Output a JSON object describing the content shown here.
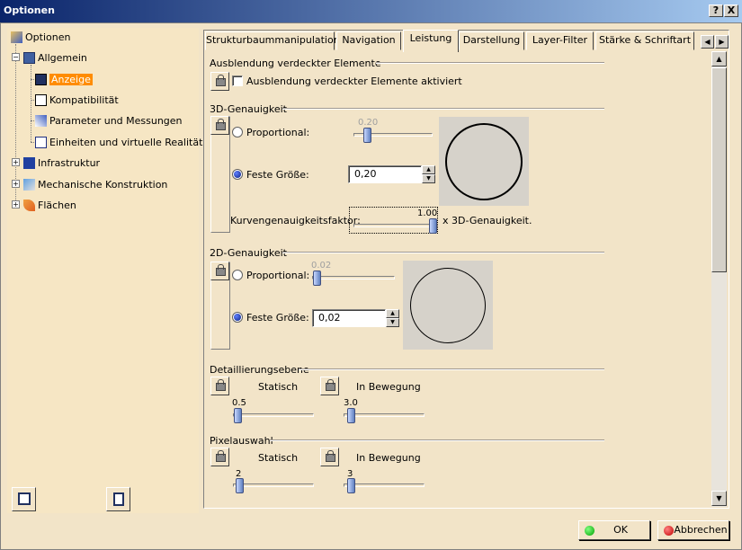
{
  "window": {
    "title": "Optionen",
    "help_label": "?",
    "close_label": "X"
  },
  "tree": {
    "root": "Optionen",
    "items": [
      {
        "label": "Allgemein"
      },
      {
        "label": "Anzeige",
        "selected": true
      },
      {
        "label": "Kompatibilität"
      },
      {
        "label": "Parameter und Messungen"
      },
      {
        "label": "Einheiten und virtuelle Realität"
      },
      {
        "label": "Infrastruktur"
      },
      {
        "label": "Mechanische Konstruktion"
      },
      {
        "label": "Flächen"
      }
    ]
  },
  "tabs": [
    {
      "label": "Strukturbaummanipulation"
    },
    {
      "label": "Navigation"
    },
    {
      "label": "Leistung",
      "active": true
    },
    {
      "label": "Darstellung"
    },
    {
      "label": "Layer-Filter"
    },
    {
      "label": "Stärke & Schriftart"
    }
  ],
  "content": {
    "hidden_section": {
      "title": "Ausblendung verdeckter Elemente",
      "checkbox_label": "Ausblendung verdeckter Elemente aktiviert",
      "checked": false
    },
    "accuracy_3d": {
      "title": "3D-Genauigkeit",
      "proportional_label": "Proportional:",
      "proportional_value": "0.20",
      "fixed_label": "Feste Größe:",
      "fixed_value": "0,20",
      "curve_label": "Kurvengenauigkeitsfaktor:",
      "curve_value": "1.00",
      "curve_suffix": "x 3D-Genauigkeit."
    },
    "accuracy_2d": {
      "title": "2D-Genauigkeit",
      "proportional_label": "Proportional:",
      "proportional_value": "0.02",
      "fixed_label": "Feste Größe:",
      "fixed_value": "0,02"
    },
    "detail_level": {
      "title": "Detaillierungsebene",
      "static_label": "Statisch",
      "moving_label": "In Bewegung",
      "static_value": "0.5",
      "moving_value": "3.0"
    },
    "pixel_culling": {
      "title": "Pixelauswahl",
      "static_label": "Statisch",
      "moving_label": "In Bewegung",
      "static_value": "2",
      "moving_value": "3"
    }
  },
  "buttons": {
    "ok": "OK",
    "cancel": "Abbrechen"
  }
}
